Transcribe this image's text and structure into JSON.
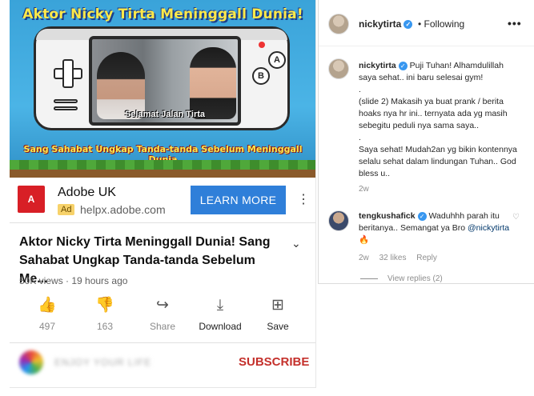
{
  "youtube": {
    "thumbnail": {
      "title": "Aktor Nicky Tirta Meninggall Dunia!",
      "screen_caption": "Selamat Jalan Tirta",
      "subtitle": "Sang Sahabat Ungkap Tanda-tanda Sebelum Meninggall Dunia",
      "button_a": "A",
      "button_b": "B"
    },
    "ad": {
      "logo_text": "A",
      "advertiser": "Adobe UK",
      "badge": "Ad",
      "url": "helpx.adobe.com",
      "cta": "LEARN MORE",
      "more": "⋮"
    },
    "video": {
      "title": "Aktor Nicky Tirta Meninggall Dunia! Sang Sahabat Ungkap Tanda-tanda Sebelum Me...",
      "meta": "50K views · 19 hours ago",
      "expand": "⌄"
    },
    "actions": [
      {
        "icon": "👍",
        "label": "497"
      },
      {
        "icon": "👎",
        "label": "163"
      },
      {
        "icon": "↪",
        "label": "Share"
      },
      {
        "icon": "⤓",
        "label": "Download"
      },
      {
        "icon": "⊞",
        "label": "Save"
      }
    ],
    "channel": {
      "name": "ENJOY YOUR LIFE",
      "subscribe": "SUBSCRIBE"
    }
  },
  "instagram": {
    "header": {
      "username": "nickytirta",
      "verified": "✓",
      "following": "• Following",
      "more": "•••"
    },
    "caption": {
      "username": "nickytirta",
      "lines": [
        "Puji Tuhan! Alhamdulillah saya sehat.. ini baru selesai gym!",
        ".",
        "(slide 2) Makasih ya buat prank / berita hoaks nya hr ini.. ternyata ada yg masih sebegitu peduli nya sama saya..",
        ".",
        "Saya sehat! Mudah2an yg bikin kontennya selalu sehat dalam lindungan Tuhan.. God bless u.."
      ],
      "time": "2w"
    },
    "comment": {
      "username": "tengkushafick",
      "text": "Waduhhh parah itu beritanya.. Semangat ya Bro",
      "mention": "@nickytirta",
      "emoji": "🔥",
      "heart": "♡",
      "time": "2w",
      "likes": "32 likes",
      "reply": "Reply",
      "view_replies": "View replies (2)"
    }
  }
}
